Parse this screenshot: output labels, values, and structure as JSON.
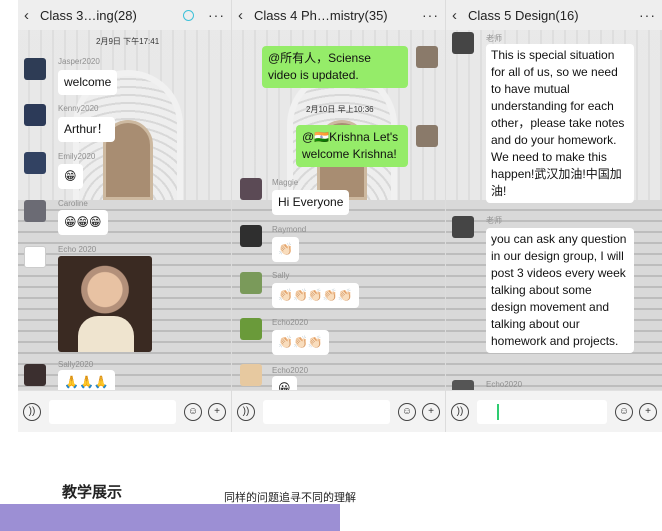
{
  "panels": [
    {
      "title": "Class 3…ing(28)",
      "time": "2月9日 下午17:41",
      "names": [
        "Jasper2020",
        "Kenny2020",
        "Emily2020",
        "Caroline",
        "Echo 2020",
        "Sally2020"
      ],
      "messages": [
        "welcome",
        "Arthur！",
        "😁",
        "😁😁😁",
        "",
        "🙏🙏🙏"
      ]
    },
    {
      "title": "Class 4 Ph…mistry(35)",
      "time": "2月10日 早上10:36",
      "names": [
        "",
        "Maggie",
        "Raymond",
        "Sally",
        "Echo2020",
        "Echo2020"
      ],
      "messages": [
        "@所有人，Sciense video is updated.",
        "@🇮🇳Krishna Let's welcome Krishna!",
        "Hi Everyone",
        "👏🏻",
        "👏🏻👏🏻👏🏻👏🏻👏🏻",
        "👏🏻👏🏻👏🏻",
        "😀"
      ]
    },
    {
      "title": "Class 5 Design(16)",
      "names": [
        "老师",
        "老师",
        "Echo2020"
      ],
      "messages": [
        "This is special situation for all of us, so we need to have mutual understanding for each other，please take notes and do your homework. We need to make this happen!武汉加油!中国加油!",
        "you can ask any question in our design group, I will post 3 videos every week talking about some design movement and talking about our homework and projects."
      ]
    }
  ],
  "footer": {
    "voice_icon": "voice-icon",
    "emoji_icon": "emoji-icon",
    "plus_icon": "plus-icon"
  },
  "caption": {
    "title": "教学展示",
    "subtitle": "同样的问题追寻不同的理解"
  },
  "colors": {
    "accent_purple": "#9c8fd4",
    "bubble_green": "#95ec69",
    "cursor_green": "#2ecc71"
  }
}
